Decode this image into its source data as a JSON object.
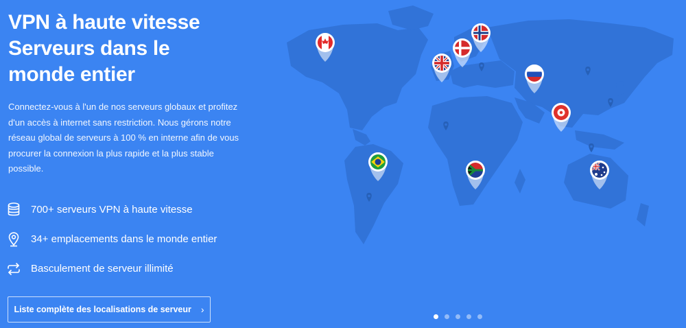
{
  "hero": {
    "title_lines": [
      "VPN à haute vitesse",
      "Serveurs dans le",
      "monde entier"
    ],
    "description": "Connectez-vous à l'un de nos serveurs globaux et profitez d'un accès à internet sans restriction. Nous gérons notre réseau global de serveurs à 100 % en interne afin de vous procurer la connexion la plus rapide et la plus stable possible.",
    "features": [
      {
        "icon": "database-icon",
        "label": "700+ serveurs VPN à haute vitesse"
      },
      {
        "icon": "location-pin-icon",
        "label": "34+ emplacements dans le monde entier"
      },
      {
        "icon": "repeat-arrows-icon",
        "label": "Basculement de serveur illimité"
      }
    ],
    "cta_label": "Liste complète des localisations de serveur",
    "cta_chevron": "›"
  },
  "map": {
    "flag_markers": [
      {
        "name": "canada-flag-marker",
        "country": "Canada"
      },
      {
        "name": "norway-flag-marker",
        "country": "Norway"
      },
      {
        "name": "denmark-flag-marker",
        "country": "Denmark"
      },
      {
        "name": "uk-flag-marker",
        "country": "United Kingdom"
      },
      {
        "name": "russia-flag-marker",
        "country": "Russia"
      },
      {
        "name": "hong-kong-flag-marker",
        "country": "Hong Kong"
      },
      {
        "name": "brazil-flag-marker",
        "country": "Brazil"
      },
      {
        "name": "south-africa-flag-marker",
        "country": "South Africa"
      },
      {
        "name": "australia-flag-marker",
        "country": "Australia"
      }
    ]
  },
  "carousel": {
    "slide_count": 5,
    "active_index": 0
  },
  "colors": {
    "background": "#3b84f2",
    "land": "#3173d8",
    "pin": "#2660b8",
    "text": "#ffffff"
  }
}
